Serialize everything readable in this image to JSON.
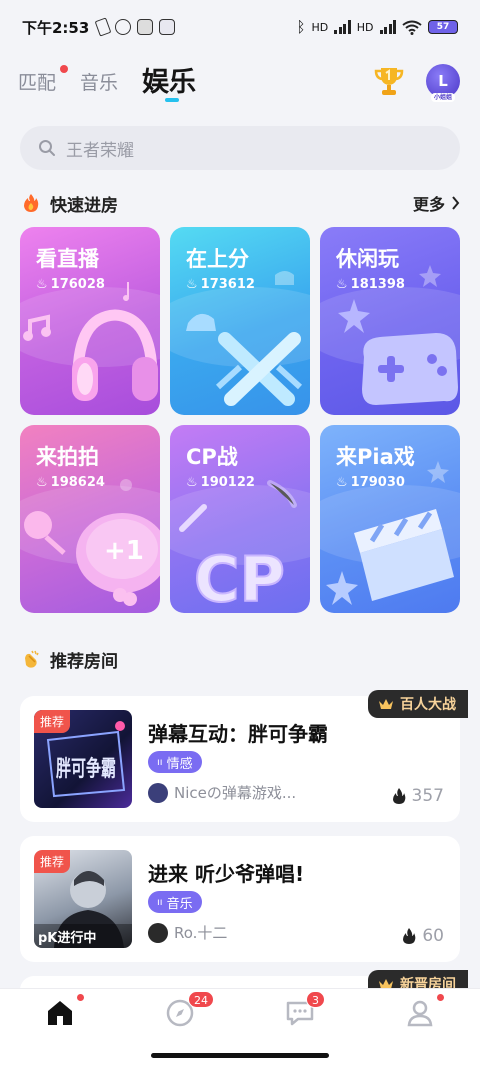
{
  "status": {
    "time": "下午2:53",
    "net1": "HD",
    "net2": "HD",
    "battery": "57"
  },
  "nav": {
    "tabs": [
      {
        "label": "匹配"
      },
      {
        "label": "音乐"
      },
      {
        "label": "娱乐"
      }
    ],
    "avatar_char": "L",
    "avatar_tag": "小姐姐"
  },
  "search": {
    "placeholder": "王者荣耀"
  },
  "quick": {
    "title": "快速进房",
    "more": "更多"
  },
  "cards": [
    {
      "title": "看直播",
      "count": "176028"
    },
    {
      "title": "在上分",
      "count": "173612"
    },
    {
      "title": "休闲玩",
      "count": "181398"
    },
    {
      "title": "来拍拍",
      "count": "198624"
    },
    {
      "title": "CP战",
      "count": "190122"
    },
    {
      "title": "来Pia戏",
      "count": "179030"
    }
  ],
  "card_art": {
    "plus_one": "+1",
    "cp": "CP"
  },
  "recommend": {
    "title": "推荐房间"
  },
  "rooms": [
    {
      "tag": "推荐",
      "badge": "百人大战",
      "title": "弹幕互动：胖可争霸",
      "category": "情感",
      "host": "Niceの弹幕游戏...",
      "heat": "357",
      "thumb_text": "胖可争霸"
    },
    {
      "tag": "推荐",
      "badge": "",
      "title": "进来 听少爷弹唱!",
      "category": "音乐",
      "host": "Ro.十二",
      "heat": "60",
      "thumb_text": "pK进行中"
    }
  ],
  "partial_badge": "新晋房间",
  "bottom": {
    "discover_badge": "24",
    "message_badge": "3"
  },
  "colors": {
    "accent": "#26c1ee",
    "badge_red": "#f0484d",
    "category_purple": "#7a6cf2"
  }
}
